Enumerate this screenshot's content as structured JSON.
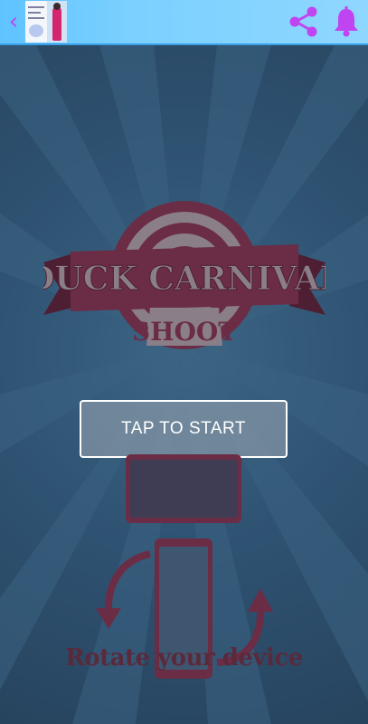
{
  "topbar": {
    "back_glyph": "‹",
    "share_icon": "share-icon",
    "bell_icon": "bell-icon",
    "accent_color": "#c044f0",
    "bar_color": "#7bd0ff"
  },
  "game": {
    "logo_line1": "DUCK CARNIVAL",
    "logo_line2": "SHOOT",
    "start_label": "TAP TO START",
    "rotate_label": "Rotate your device",
    "ribbon_color": "#6b2d45",
    "background_color": "#2f5373"
  }
}
